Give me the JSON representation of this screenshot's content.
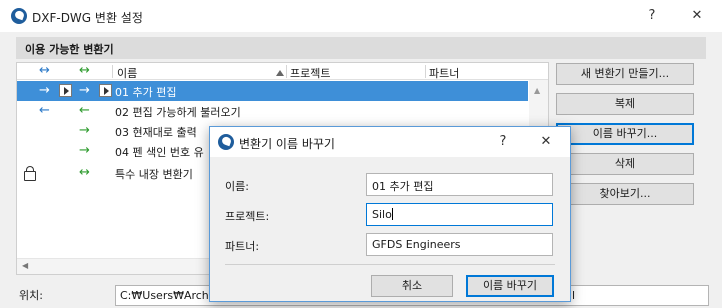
{
  "window": {
    "title": "DXF-DWG 변환 설정",
    "help_glyph": "?",
    "close_glyph": "✕"
  },
  "section": {
    "title": "이용 가능한 변환기"
  },
  "list": {
    "columns": [
      "이름",
      "프로젝트",
      "파트너"
    ],
    "rows": [
      {
        "name": "01 추가 편집",
        "selected": true
      },
      {
        "name": "02 편집 가능하게 불러오기"
      },
      {
        "name": "03 현재대로 출력"
      },
      {
        "name": "04 펜 색인 번호 유"
      },
      {
        "name": "특수 내장 변환기"
      }
    ],
    "arrows": {
      "both": "↔",
      "left": "←",
      "right": "→"
    },
    "scroll_up_glyph": "▲",
    "scroll_left_glyph": "◀"
  },
  "side_buttons": {
    "new": "새 변환기 만들기...",
    "duplicate": "복제",
    "rename": "이름 바꾸기...",
    "delete": "삭제",
    "browse": "찾아보기..."
  },
  "location": {
    "label": "위치:",
    "value": "C:₩Users₩ArchiGr",
    "tail": "l"
  },
  "dialog": {
    "title": "변환기 이름 바꾸기",
    "help_glyph": "?",
    "close_glyph": "✕",
    "name_label": "이름:",
    "name_value": "01 추가 편집",
    "project_label": "프로젝트:",
    "project_value": "Silo",
    "partner_label": "파트너:",
    "partner_value": "GFDS Engineers",
    "cancel_label": "취소",
    "ok_label": "이름 바꾸기"
  }
}
